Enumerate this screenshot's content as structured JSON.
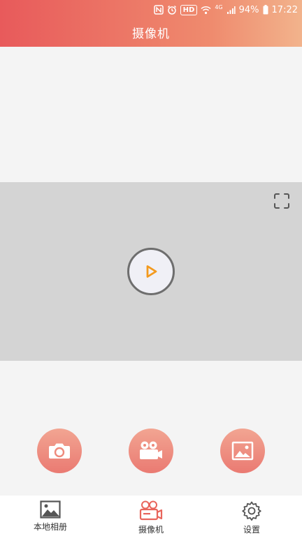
{
  "status_bar": {
    "network": "4G",
    "hd": "HD",
    "battery": "94%",
    "time": "17:22"
  },
  "header": {
    "title": "摄像机"
  },
  "player": {
    "play_icon": "play-icon",
    "fullscreen_icon": "fullscreen-icon"
  },
  "actions": [
    {
      "icon": "camera-icon"
    },
    {
      "icon": "video-camera-icon"
    },
    {
      "icon": "image-icon"
    }
  ],
  "bottom_nav": {
    "items": [
      {
        "label": "本地相册",
        "icon": "gallery-icon"
      },
      {
        "label": "摄像机",
        "icon": "video-camera-icon",
        "active": true
      },
      {
        "label": "设置",
        "icon": "gear-icon"
      }
    ]
  },
  "colors": {
    "header_start": "#e85a5b",
    "header_end": "#f2b38c",
    "accent": "#e8655c",
    "play_accent": "#f39a1e"
  }
}
